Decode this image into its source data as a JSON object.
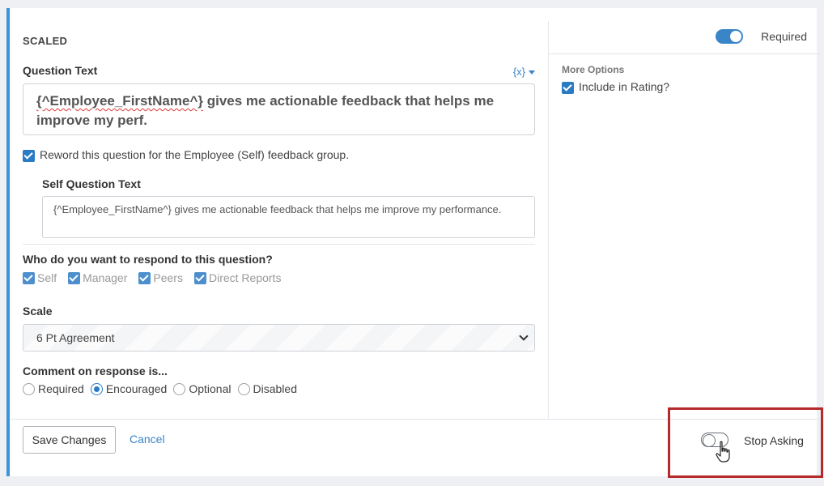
{
  "question": {
    "type_label": "SCALED",
    "text_label": "Question Text",
    "variable_button": "{x}",
    "text_var": "{^Employee_FirstName^}",
    "text_rest": " gives me actionable feedback that helps me improve my perf.",
    "reword_label": "Reword this question for the Employee (Self) feedback group.",
    "self_label": "Self Question Text",
    "self_text": "{^Employee_FirstName^} gives me actionable feedback that helps me improve my performance."
  },
  "respondents": {
    "label": "Who do you want to respond to this question?",
    "options": [
      "Self",
      "Manager",
      "Peers",
      "Direct Reports"
    ]
  },
  "scale": {
    "label": "Scale",
    "selected": "6 Pt Agreement"
  },
  "comment": {
    "label": "Comment on response is...",
    "options": [
      "Required",
      "Encouraged",
      "Optional",
      "Disabled"
    ],
    "selected": "Encouraged"
  },
  "right_panel": {
    "required_label": "Required",
    "more_options_label": "More Options",
    "include_rating_label": "Include in Rating?"
  },
  "footer": {
    "save_label": "Save Changes",
    "cancel_label": "Cancel",
    "stop_asking_label": "Stop Asking"
  },
  "colors": {
    "accent": "#3a84c8",
    "highlight_box": "#b52a2a"
  }
}
